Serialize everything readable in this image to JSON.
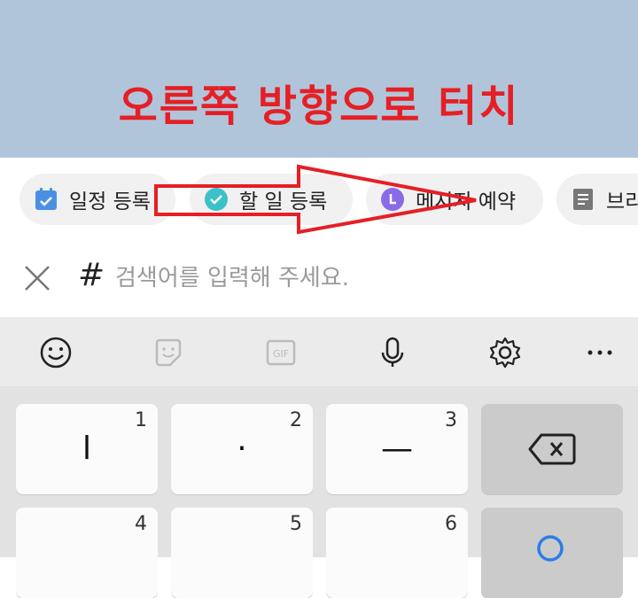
{
  "instruction": "오른쪽 방향으로 터치",
  "chips": [
    {
      "label": "일정 등록",
      "icon": "calendar-icon"
    },
    {
      "label": "할 일 등록",
      "icon": "check-circle-icon"
    },
    {
      "label": "메시지 예약",
      "icon": "message-clock-icon"
    },
    {
      "label": "브리",
      "icon": "document-icon"
    }
  ],
  "search": {
    "hash": "#",
    "placeholder": "검색어를 입력해 주세요."
  },
  "keyboard": {
    "toolbar": [
      "emoji-icon",
      "sticker-icon",
      "gif-icon",
      "microphone-icon",
      "settings-icon",
      "more-icon"
    ],
    "gif_label": "GIF",
    "keys": [
      {
        "glyph": "l",
        "num": "1"
      },
      {
        "glyph": "·",
        "num": "2"
      },
      {
        "glyph": "—",
        "num": "3"
      },
      {
        "glyph": "",
        "num": "4"
      },
      {
        "glyph": "",
        "num": "5"
      },
      {
        "glyph": "",
        "num": "6"
      }
    ]
  },
  "colors": {
    "instruction": "#e51f25",
    "header_bg": "#b1c5da",
    "arrow": "#e51f25",
    "calendar": "#4a90e2",
    "check": "#3cc1c8",
    "message": "#8a6be6"
  }
}
